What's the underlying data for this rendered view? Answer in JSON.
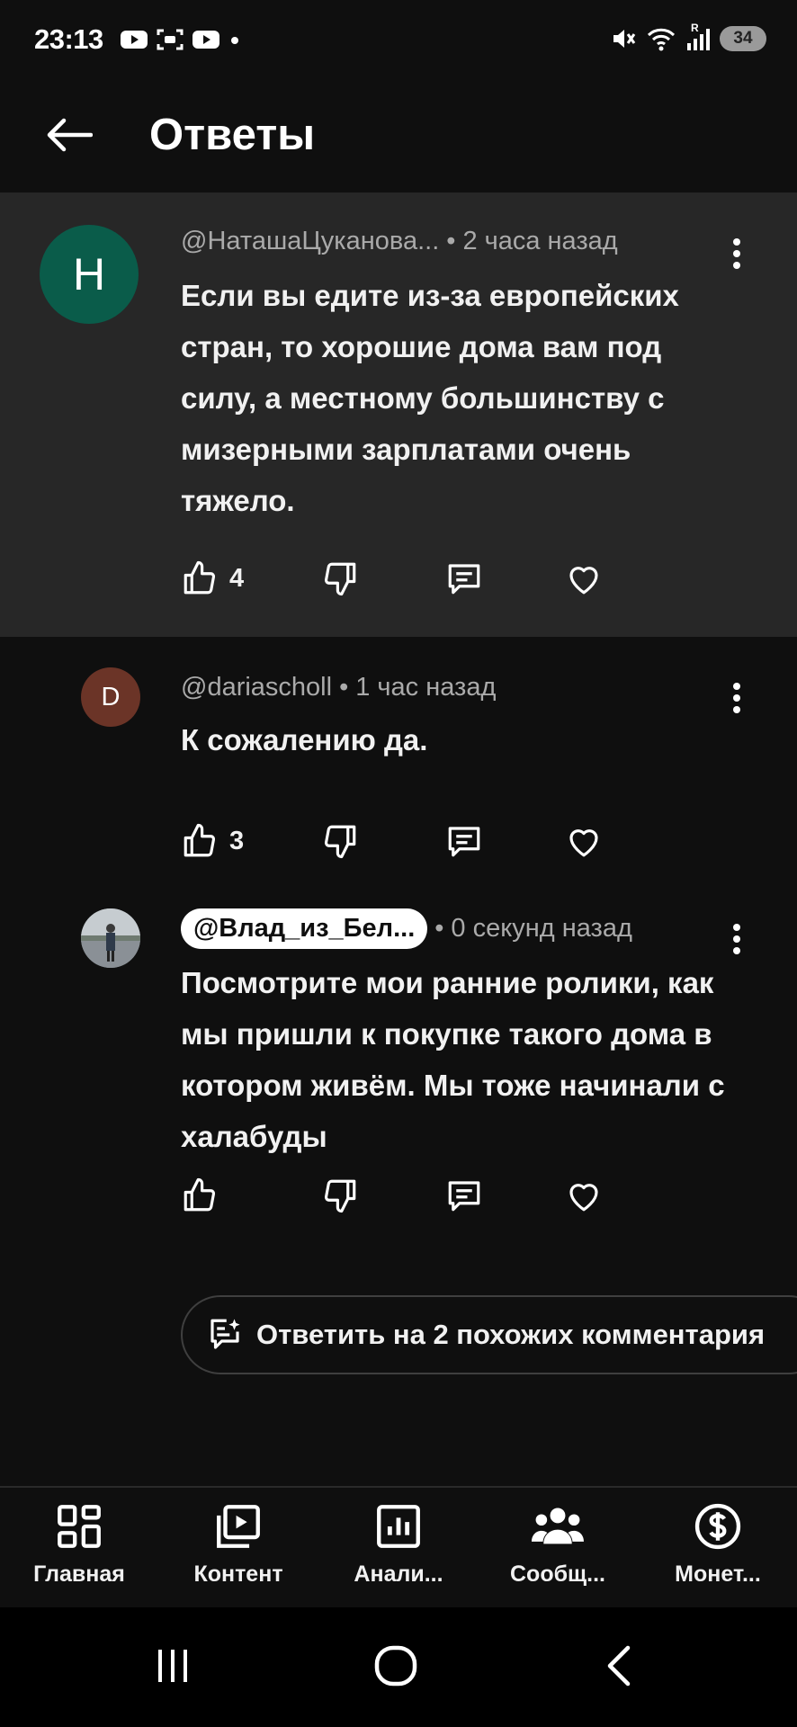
{
  "status_bar": {
    "time": "23:13",
    "battery": "34",
    "signal_label": "R"
  },
  "header": {
    "title": "Ответы"
  },
  "comments": [
    {
      "avatar_letter": "Н",
      "avatar_color": "#0a5c4a",
      "author": "@НаташаЦуканова...",
      "time": "2 часа назад",
      "text": "Если вы едите из-за европейских стран, то хорошие дома вам под силу, а местному большинству с мизерными зарплатами очень тяжело.",
      "likes": "4"
    },
    {
      "avatar_letter": "D",
      "avatar_color": "#6b3427",
      "author": "@dariascholl",
      "time": "1 час назад",
      "text": "К сожалению да.",
      "likes": "3"
    },
    {
      "avatar_letter": "",
      "author": "@Влад_из_Бел...",
      "time": "0 секунд назад",
      "text": "Посмотрите  мои ранние ролики, как мы пришли к покупке такого дома в котором живём. Мы тоже начинали с халабуды",
      "likes": ""
    }
  ],
  "reply_similar": {
    "label": "Ответить на 2 похожих комментария"
  },
  "bottom_nav": [
    {
      "label": "Главная",
      "icon": "dashboard-icon"
    },
    {
      "label": "Контент",
      "icon": "content-icon"
    },
    {
      "label": "Анали...",
      "icon": "analytics-icon"
    },
    {
      "label": "Сообщ...",
      "icon": "community-icon"
    },
    {
      "label": "Монет...",
      "icon": "monetization-icon"
    }
  ]
}
